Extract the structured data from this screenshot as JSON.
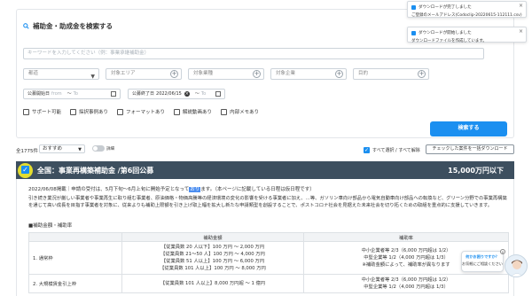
{
  "search": {
    "title": "補助金・助成金を検索する",
    "keyword_placeholder": "キーワードを入力してください（例：事業承継補助金）",
    "selects": [
      {
        "label": "都道",
        "type": "dropdown"
      },
      {
        "label": "対象エリア",
        "type": "plus"
      },
      {
        "label": "対象業種",
        "type": "plus"
      },
      {
        "label": "対象企業",
        "type": "plus"
      },
      {
        "label": "目的",
        "type": "plus"
      }
    ],
    "dates": [
      {
        "label": "公募開始日",
        "from": "from",
        "sep": "～",
        "to": "To"
      },
      {
        "label": "公募終了日",
        "from": "2022/06/15",
        "sep": "～",
        "to": "To"
      }
    ],
    "checkboxes": [
      "サポート可能",
      "採択事例あり",
      "フォーマットあり",
      "解説動画あり",
      "内部メモあり"
    ],
    "search_button": "検索する"
  },
  "toasts": [
    {
      "title": "ダウンロードが完了しました",
      "body": "ご登録のメールアドレス(Codoclip-20220615-112111.csv)を便りのファ..."
    },
    {
      "title": "ダウンロードが開始しました",
      "body": "ダウンロードファイルを作成しています。"
    }
  ],
  "results": {
    "count": "全1775件",
    "sort": "おすすめ",
    "toggle_label": "詳細",
    "select_all": "すべて選択 / すべて解除",
    "download_button": "チェックした案件を一括ダウンロード"
  },
  "card": {
    "title": "全国：事業再構築補助金 /第6回公募",
    "amount": "15,000万円以下",
    "dates_pre": "2022/06/08掲載｜申請の受付は、5月下旬～6月上旬に開始予定となって",
    "dates_hl": "おり",
    "dates_post": "ます。（本ページに記載している日程は仮日程です）",
    "description": "引き続き業況が厳しい事業者や事業再生に取り組む事業者、原油価格・物価高騰等の経済環境の変化の影響を受ける事業者に加え、…等、ガソリン車向け部品から電気自動車向け部品への転換など、グリーン分野での事業再構築を通じて高い成長を目指す事業者を対象に、従来よりも補助上限額を引き上げ取上幅を拡大し新たな申請類型を創設することで、ポストコロナ社会を見据えた未来社会を切り拓くための取組を重点的に支援していきます。",
    "scope_label": "■補助金額・補助率",
    "table": {
      "headers": [
        "",
        "補助金額",
        "補助率"
      ],
      "rows": [
        {
          "kind": "1. 通常枠",
          "amount": [
            "【従業員数 20 人以下】100 万円 ～ 2,000 万円",
            "【従業員数 21～50 人】100 万円 ～ 4,000 万円",
            "【従業員数 51 人以上】100 万円 ～ 6,000 万円",
            "【従業員数 101 人以上】100 万円 ～ 8,000 万円"
          ],
          "rate": [
            "中小企業者等 2/3（6,000 万円超は 1/2）",
            "中堅企業等 1/2（4,000 万円超は 1/3）",
            "※補助金額によって、補助率が異なります"
          ]
        },
        {
          "kind": "2. 大規模賃金引上枠",
          "amount": [
            "【従業員数 101 人以上】8,000 万円超 ～ 1 億円"
          ],
          "rate": [
            "中小企業者等 2/3（6,000 万円超は 1/2）",
            "中堅企業等 1/2（4,000 万円超は 1/3）"
          ]
        }
      ]
    }
  },
  "chat": {
    "line1": "何かお困りですか？",
    "line2": "お気軽にご相談ください"
  },
  "colors": {
    "accent": "#1b8ff0",
    "card_header": "#3d4f5f",
    "highlight": "#fff528"
  }
}
